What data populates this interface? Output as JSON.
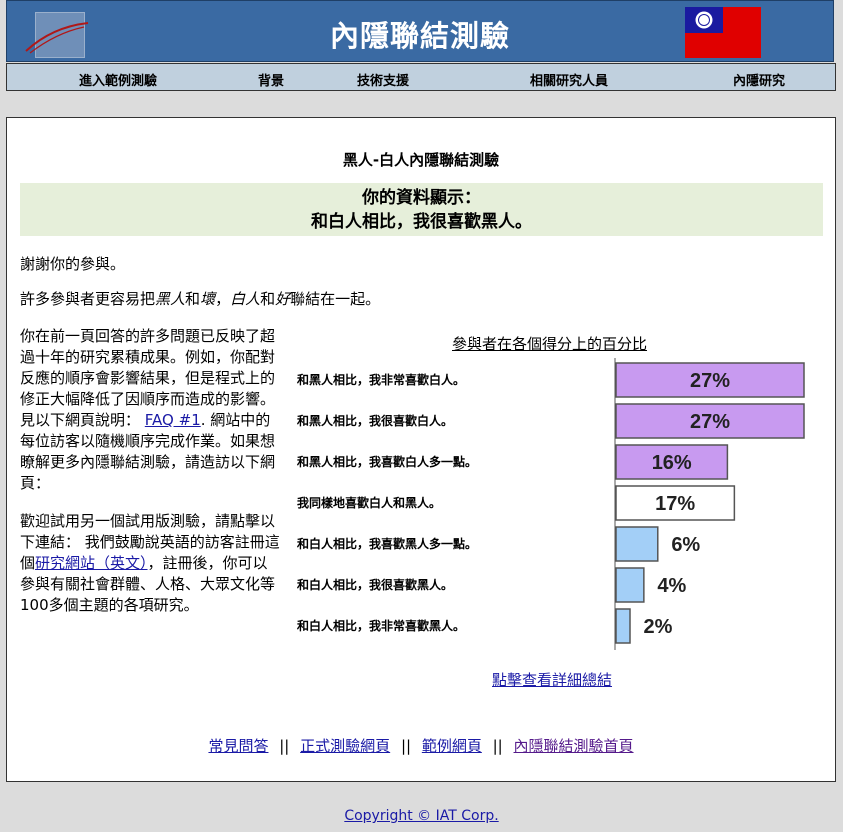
{
  "header": {
    "title": "內隱聯結測驗"
  },
  "nav": {
    "items": [
      "進入範例測驗",
      "背景",
      "技術支援",
      "相關研究人員",
      "內隱研究"
    ]
  },
  "main": {
    "test_title": "黑人-白人內隱聯結測驗",
    "result_line1": "你的資料顯示：",
    "result_line2": "和白人相比，我很喜歡黑人。",
    "thanks": "謝謝你的參與。",
    "assoc_1": "許多參與者更容易把",
    "assoc_black": "黑人",
    "assoc_and1": "和",
    "assoc_bad": "壞",
    "assoc_comma": "，",
    "assoc_white": "白人",
    "assoc_and2": "和",
    "assoc_good": "好",
    "assoc_2": "聯結在一起。",
    "para1_text": "你在前一頁回答的許多問題已反映了超過十年的研究累積成果。例如，你配對反應的順序會影響結果，但是程式上的修正大幅降低了因順序而造成的影響。見以下網頁說明：",
    "para1_link": "FAQ #1",
    "para1_text2": ". 網站中的每位訪客以隨機順序完成作業。如果想瞭解更多內隱聯結測驗，請造訪以下網頁：",
    "para2_text": "歡迎試用另一個試用版測驗，請點擊以下連結： 我們鼓勵說英語的訪客註冊這個",
    "para2_link": "研究網站（英文）",
    "para2_text2": "，註冊後，你可以參與有關社會群體、人格、大眾文化等100多個主題的各項研究。",
    "details_link": "點擊查看詳細總結"
  },
  "chart_data": {
    "type": "bar",
    "title": "參與者在各個得分上的百分比",
    "categories": [
      "和黑人相比，我非常喜歡白人。",
      "和黑人相比，我很喜歡白人。",
      "和黑人相比，我喜歡白人多一點。",
      "我同樣地喜歡白人和黑人。",
      "和白人相比，我喜歡黑人多一點。",
      "和白人相比，我很喜歡黑人。",
      "和白人相比，我非常喜歡黑人。"
    ],
    "values": [
      27,
      27,
      16,
      17,
      6,
      4,
      2
    ],
    "labels": [
      "27%",
      "27%",
      "16%",
      "17%",
      "6%",
      "4%",
      "2%"
    ],
    "colors": [
      "#c89af0",
      "#c89af0",
      "#c89af0",
      "#ffffff",
      "#a3cff7",
      "#a3cff7",
      "#a3cff7"
    ],
    "xlim": [
      0,
      27
    ],
    "orientation": "horizontal"
  },
  "footer": {
    "links": [
      "常見問答",
      "正式測驗網頁",
      "範例網頁",
      "內隱聯結測驗首頁"
    ],
    "separator": "||"
  },
  "copyright": "Copyright © IAT Corp."
}
